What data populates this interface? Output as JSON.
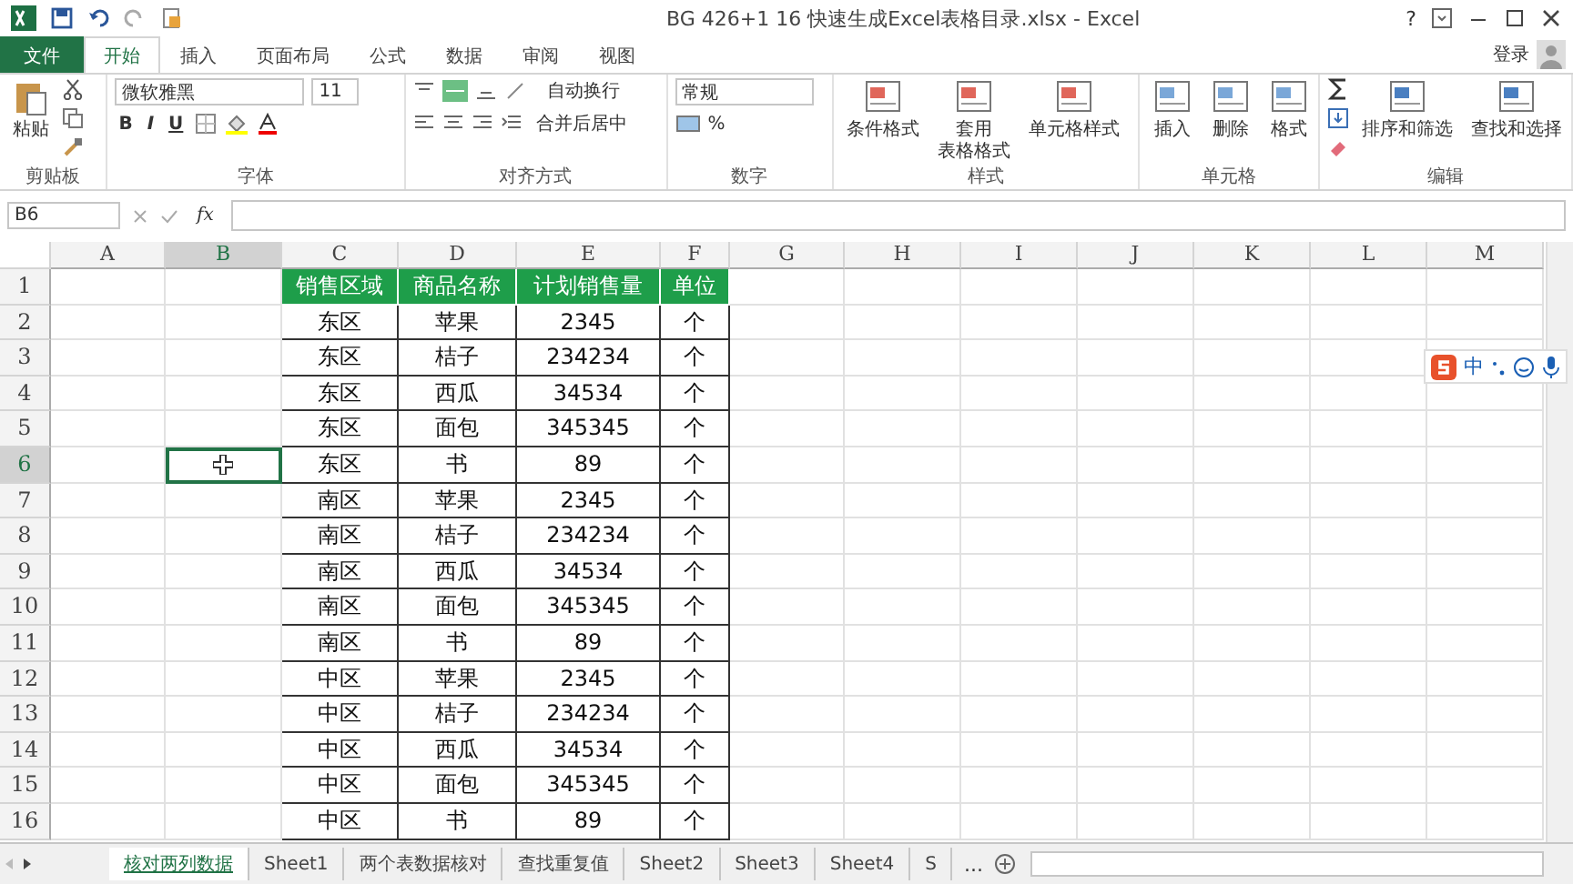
{
  "title_bar": {
    "title": "BG 426+1 16 快速生成Excel表格目录.xlsx - Excel",
    "help": "?"
  },
  "menu_tabs": [
    {
      "label": "文件",
      "kind": "file",
      "selected": false
    },
    {
      "label": "开始",
      "kind": "tab",
      "selected": true
    },
    {
      "label": "插入",
      "kind": "tab",
      "selected": false
    },
    {
      "label": "页面布局",
      "kind": "tab",
      "selected": false
    },
    {
      "label": "公式",
      "kind": "tab",
      "selected": false
    },
    {
      "label": "数据",
      "kind": "tab",
      "selected": false
    },
    {
      "label": "审阅",
      "kind": "tab",
      "selected": false
    },
    {
      "label": "视图",
      "kind": "tab",
      "selected": false
    }
  ],
  "login": "登录",
  "ribbon": {
    "clipboard": {
      "label": "剪贴板",
      "paste": "粘贴"
    },
    "font": {
      "label": "字体",
      "font_name": "微软雅黑",
      "font_size": "11",
      "bold": "B",
      "italic": "I",
      "underline": "U"
    },
    "alignment": {
      "label": "对齐方式",
      "wrap": "自动换行",
      "merge": "合并后居中"
    },
    "number": {
      "label": "数字",
      "format": "常规",
      "percent": "%"
    },
    "styles": {
      "label": "样式",
      "buttons": [
        {
          "lines": [
            "条件格式"
          ]
        },
        {
          "lines": [
            "套用",
            "表格格式"
          ]
        },
        {
          "lines": [
            "单元格样式"
          ]
        }
      ]
    },
    "cells": {
      "label": "单元格",
      "buttons": [
        {
          "lines": [
            "插入"
          ]
        },
        {
          "lines": [
            "删除"
          ]
        },
        {
          "lines": [
            "格式"
          ]
        }
      ]
    },
    "editing": {
      "label": "编辑",
      "buttons": [
        {
          "lines": [
            "排序和筛选"
          ]
        },
        {
          "lines": [
            "查找和选择"
          ]
        }
      ]
    }
  },
  "name_box": "B6",
  "fx": "fx",
  "columns": [
    {
      "label": "A",
      "selected": false
    },
    {
      "label": "B",
      "selected": true
    },
    {
      "label": "C",
      "selected": false
    },
    {
      "label": "D",
      "selected": false
    },
    {
      "label": "E",
      "selected": false
    },
    {
      "label": "F",
      "selected": false
    },
    {
      "label": "G",
      "selected": false
    },
    {
      "label": "H",
      "selected": false
    },
    {
      "label": "I",
      "selected": false
    },
    {
      "label": "J",
      "selected": false
    },
    {
      "label": "K",
      "selected": false
    },
    {
      "label": "L",
      "selected": false
    },
    {
      "label": "M",
      "selected": false
    }
  ],
  "rows": [
    {
      "label": "1",
      "selected": false
    },
    {
      "label": "2",
      "selected": false
    },
    {
      "label": "3",
      "selected": false
    },
    {
      "label": "4",
      "selected": false
    },
    {
      "label": "5",
      "selected": false
    },
    {
      "label": "6",
      "selected": true
    },
    {
      "label": "7",
      "selected": false
    },
    {
      "label": "8",
      "selected": false
    },
    {
      "label": "9",
      "selected": false
    },
    {
      "label": "10",
      "selected": false
    },
    {
      "label": "11",
      "selected": false
    },
    {
      "label": "12",
      "selected": false
    },
    {
      "label": "13",
      "selected": false
    },
    {
      "label": "14",
      "selected": false
    },
    {
      "label": "15",
      "selected": false
    },
    {
      "label": "16",
      "selected": false
    }
  ],
  "table": {
    "header": [
      "销售区域",
      "商品名称",
      "计划销售量",
      "单位"
    ],
    "rows": [
      [
        "东区",
        "苹果",
        "2345",
        "个"
      ],
      [
        "东区",
        "桔子",
        "234234",
        "个"
      ],
      [
        "东区",
        "西瓜",
        "34534",
        "个"
      ],
      [
        "东区",
        "面包",
        "345345",
        "个"
      ],
      [
        "东区",
        "书",
        "89",
        "个"
      ],
      [
        "南区",
        "苹果",
        "2345",
        "个"
      ],
      [
        "南区",
        "桔子",
        "234234",
        "个"
      ],
      [
        "南区",
        "西瓜",
        "34534",
        "个"
      ],
      [
        "南区",
        "面包",
        "345345",
        "个"
      ],
      [
        "南区",
        "书",
        "89",
        "个"
      ],
      [
        "中区",
        "苹果",
        "2345",
        "个"
      ],
      [
        "中区",
        "桔子",
        "234234",
        "个"
      ],
      [
        "中区",
        "西瓜",
        "34534",
        "个"
      ],
      [
        "中区",
        "面包",
        "345345",
        "个"
      ],
      [
        "中区",
        "书",
        "89",
        "个"
      ]
    ]
  },
  "sheet_tabs": [
    {
      "label": "核对两列数据",
      "selected": true
    },
    {
      "label": "Sheet1",
      "selected": false
    },
    {
      "label": "两个表数据核对",
      "selected": false
    },
    {
      "label": "查找重复值",
      "selected": false
    },
    {
      "label": "Sheet2",
      "selected": false
    },
    {
      "label": "Sheet3",
      "selected": false
    },
    {
      "label": "Sheet4",
      "selected": false
    },
    {
      "label": "S",
      "selected": false
    }
  ],
  "more_sheets": "...",
  "ime_toolbar": {
    "mode": "中"
  }
}
